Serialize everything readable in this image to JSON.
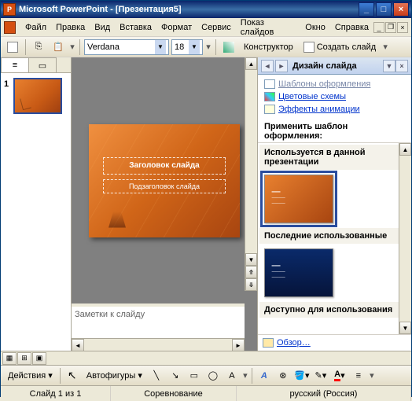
{
  "titlebar": {
    "app": "Microsoft PowerPoint",
    "doc": "[Презентация5]"
  },
  "menu": [
    "Файл",
    "Правка",
    "Вид",
    "Вставка",
    "Формат",
    "Сервис",
    "Показ слайдов",
    "Окно",
    "Справка"
  ],
  "toolbar": {
    "font": "Verdana",
    "font_size": "18",
    "designer": "Конструктор",
    "new_slide": "Создать слайд"
  },
  "thumbs": {
    "slide_number": "1"
  },
  "slide": {
    "title_placeholder": "Заголовок слайда",
    "subtitle_placeholder": "Подзаголовок слайда"
  },
  "notes": {
    "placeholder": "Заметки к слайду"
  },
  "task_pane": {
    "title": "Дизайн слайда",
    "links": [
      "Шаблоны оформления",
      "Цветовые схемы",
      "Эффекты анимации"
    ],
    "apply_label": "Применить шаблон оформления:",
    "groups": {
      "used": "Используется в данной презентации",
      "recent": "Последние использованные",
      "available": "Доступно для использования"
    },
    "browse": "Обзор…"
  },
  "draw_toolbar": {
    "actions": "Действия",
    "autoshapes": "Автофигуры"
  },
  "status": {
    "slide": "Слайд 1 из 1",
    "template": "Соревнование",
    "language": "русский (Россия)"
  },
  "colors": {
    "accent": "#d54f10",
    "selection": "#2a4d9e",
    "link": "#0033cc"
  },
  "chart_data": null
}
